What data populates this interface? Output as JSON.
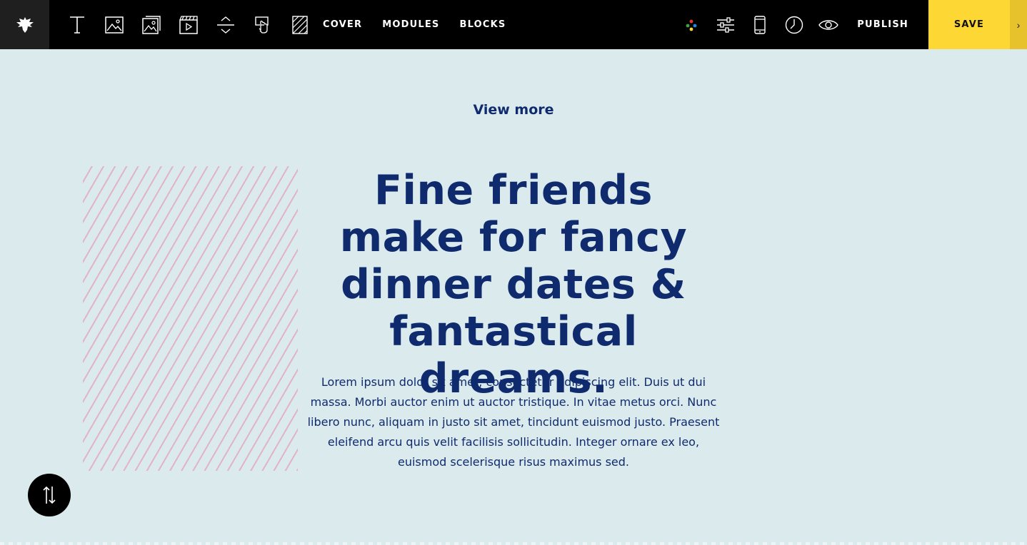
{
  "toolbar": {
    "logo_icon": "eagle-logo-icon",
    "tools": [
      {
        "name": "text-tool-icon"
      },
      {
        "name": "image-tool-icon"
      },
      {
        "name": "gallery-tool-icon"
      },
      {
        "name": "video-tool-icon"
      },
      {
        "name": "spacer-tool-icon"
      },
      {
        "name": "button-tool-icon"
      },
      {
        "name": "pattern-tool-icon"
      }
    ],
    "nav": {
      "cover": "COVER",
      "modules": "MODULES",
      "blocks": "BLOCKS"
    },
    "right_tools": [
      {
        "name": "color-palette-icon"
      },
      {
        "name": "settings-sliders-icon"
      },
      {
        "name": "mobile-preview-icon"
      },
      {
        "name": "history-clock-icon"
      },
      {
        "name": "preview-eye-icon"
      }
    ],
    "publish_label": "PUBLISH",
    "save_label": "SAVE",
    "expand_glyph": "›"
  },
  "content": {
    "view_more": "View more",
    "headline": "Fine friends make for fancy dinner dates & fantastical dreams.",
    "body": "Lorem ipsum dolor sit amet, consectetur adipiscing elit. Duis ut dui massa. Morbi auctor enim ut auctor tristique. In vitae metus orci. Nunc libero nunc, aliquam in justo sit amet, tincidunt euismod justo. Praesent eleifend arcu quis velit facilisis sollicitudin. Integer ornare ex leo, euismod scelerisque risus maximus sed."
  },
  "fab": {
    "icon": "reorder-arrows-icon"
  },
  "colors": {
    "accent": "#fdd835",
    "text": "#0f2b6e",
    "background": "#dbeaec",
    "placeholder_stripe": "#e1aabe"
  }
}
